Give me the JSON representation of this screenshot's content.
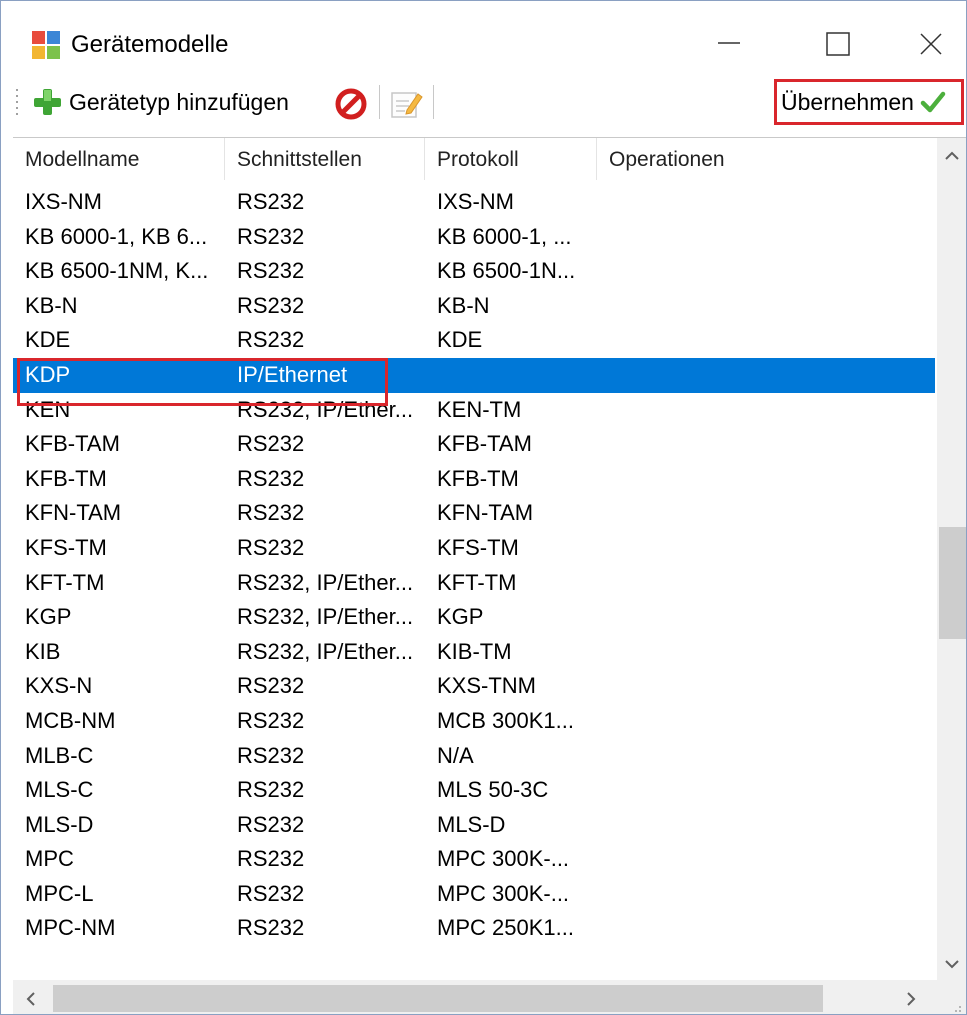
{
  "window": {
    "title": "Gerätemodelle",
    "controls": [
      "minimize",
      "maximize",
      "close"
    ]
  },
  "toolbar": {
    "add_label": "Gerätetyp hinzufügen",
    "apply_label": "Übernehmen",
    "icons": {
      "add": "plus-icon",
      "delete": "no-entry-icon",
      "edit": "edit-icon",
      "apply": "checkmark-icon"
    },
    "colors": {
      "highlight": "#d9262c",
      "selection": "#0078d7",
      "check": "#4caf3c"
    }
  },
  "table": {
    "columns": [
      "Modellname",
      "Schnittstellen",
      "Protokoll",
      "Operationen"
    ],
    "selected_index": 5,
    "rows": [
      [
        "IXS-NM",
        "RS232",
        "IXS-NM",
        ""
      ],
      [
        "KB 6000-1, KB 6...",
        "RS232",
        "KB 6000-1, ...",
        ""
      ],
      [
        "KB 6500-1NM, K...",
        "RS232",
        "KB 6500-1N...",
        ""
      ],
      [
        "KB-N",
        "RS232",
        "KB-N",
        ""
      ],
      [
        "KDE",
        "RS232",
        "KDE",
        ""
      ],
      [
        "KDP",
        "IP/Ethernet",
        "",
        ""
      ],
      [
        "KEN",
        "RS232, IP/Ether...",
        "KEN-TM",
        ""
      ],
      [
        "KFB-TAM",
        "RS232",
        "KFB-TAM",
        ""
      ],
      [
        "KFB-TM",
        "RS232",
        "KFB-TM",
        ""
      ],
      [
        "KFN-TAM",
        "RS232",
        "KFN-TAM",
        ""
      ],
      [
        "KFS-TM",
        "RS232",
        "KFS-TM",
        ""
      ],
      [
        "KFT-TM",
        "RS232, IP/Ether...",
        "KFT-TM",
        ""
      ],
      [
        "KGP",
        "RS232, IP/Ether...",
        "KGP",
        ""
      ],
      [
        "KIB",
        "RS232, IP/Ether...",
        "KIB-TM",
        ""
      ],
      [
        "KXS-N",
        "RS232",
        "KXS-TNM",
        ""
      ],
      [
        "MCB-NM",
        "RS232",
        "MCB 300K1...",
        ""
      ],
      [
        "MLB-C",
        "RS232",
        "N/A",
        ""
      ],
      [
        "MLS-C",
        "RS232",
        "MLS 50-3C",
        ""
      ],
      [
        "MLS-D",
        "RS232",
        "MLS-D",
        ""
      ],
      [
        "MPC",
        "RS232",
        "MPC 300K-...",
        ""
      ],
      [
        "MPC-L",
        "RS232",
        "MPC 300K-...",
        ""
      ],
      [
        "MPC-NM",
        "RS232",
        "MPC 250K1...",
        ""
      ],
      [
        "",
        "",
        "",
        ""
      ]
    ]
  }
}
